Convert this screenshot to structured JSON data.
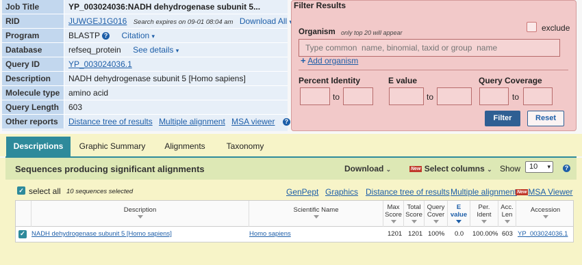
{
  "job": {
    "rows": [
      {
        "label": "Job Title",
        "value": "YP_003024036:NADH dehydrogenase subunit 5..."
      },
      {
        "label": "RID",
        "value": "JUWGEJ1G016",
        "note": "Search expires on 09-01 08:04 am",
        "link": "Download All"
      },
      {
        "label": "Program",
        "value": "BLASTP",
        "link": "Citation"
      },
      {
        "label": "Database",
        "value": "refseq_protein",
        "link": "See details"
      },
      {
        "label": "Query ID",
        "value": "YP_003024036.1"
      },
      {
        "label": "Description",
        "value": "NADH dehydrogenase subunit 5 [Homo sapiens]"
      },
      {
        "label": "Molecule type",
        "value": "amino acid"
      },
      {
        "label": "Query Length",
        "value": "603"
      },
      {
        "label": "Other reports",
        "links": [
          "Distance tree of results",
          "Multiple alignment",
          "MSA viewer"
        ]
      }
    ]
  },
  "filter": {
    "title": "Filter Results",
    "organism_label": "Organism",
    "organism_note": "only top 20 will appear",
    "exclude_label": "exclude",
    "organism_placeholder": "Type common  name, binomial, taxid or group  name",
    "add_organism": "Add organism",
    "percent_identity": "Percent Identity",
    "e_value": "E value",
    "query_coverage": "Query Coverage",
    "to": "to",
    "filter_button": "Filter",
    "reset_button": "Reset"
  },
  "tabs": [
    "Descriptions",
    "Graphic Summary",
    "Alignments",
    "Taxonomy"
  ],
  "results": {
    "title": "Sequences producing significant alignments",
    "download": "Download",
    "new_badge": "New",
    "select_columns": "Select columns",
    "show_label": "Show",
    "show_value": "10",
    "select_all": "select all",
    "selected_count": "10 sequences selected",
    "links": [
      "GenPept",
      "Graphics",
      "Distance tree of results",
      "Multiple alignment",
      "MSA Viewer"
    ],
    "columns": [
      "Description",
      "Scientific Name",
      "Max Score",
      "Total Score",
      "Query Cover",
      "E value",
      "Per. Ident",
      "Acc. Len",
      "Accession"
    ],
    "rows": [
      {
        "description": "NADH dehydrogenase subunit 5 [Homo sapiens]",
        "scientific_name": "Homo sapiens",
        "max_score": "1201",
        "total_score": "1201",
        "query_cover": "100%",
        "e_value": "0.0",
        "per_ident": "100.00%",
        "acc_len": "603",
        "accession": "YP_003024036.1"
      }
    ]
  },
  "colors": {
    "accent": "#2e8a9b",
    "link": "#1d5ea8",
    "job_panel": "#e7eff8",
    "filter_panel": "#f2c9c9",
    "results_bg": "#f7f4c8"
  }
}
